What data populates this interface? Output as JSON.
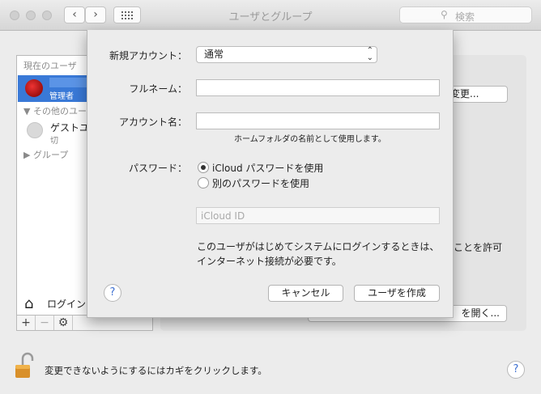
{
  "window": {
    "title": "ユーザとグループ"
  },
  "search": {
    "placeholder": "検索"
  },
  "sidebar": {
    "current_users_header": "現在のユーザ",
    "admin_role": "管理者",
    "other_users_header": "その他のユー",
    "guest_name": "ゲストユ",
    "guest_status": "切",
    "groups_header": "グループ",
    "login_label": "ログイン"
  },
  "background": {
    "change_button": "変更...",
    "allow_text": "ことを許可",
    "open_button": "を開く..."
  },
  "lock_text": "変更できないようにするにはカギをクリックします。",
  "sheet": {
    "new_account_label": "新規アカウント：",
    "account_type": "通常",
    "full_name_label": "フルネーム：",
    "full_name_value": "",
    "account_name_label": "アカウント名：",
    "account_name_value": "",
    "account_name_hint": "ホームフォルダの名前として使用します。",
    "password_label": "パスワード：",
    "option_icloud": "iCloud パスワードを使用",
    "option_other": "別のパスワードを使用",
    "icloud_id_placeholder": "iCloud ID",
    "note": "このユーザがはじめてシステムにログインするときは、インターネット接続が必要です。",
    "cancel_button": "キャンセル",
    "create_button": "ユーザを作成"
  }
}
